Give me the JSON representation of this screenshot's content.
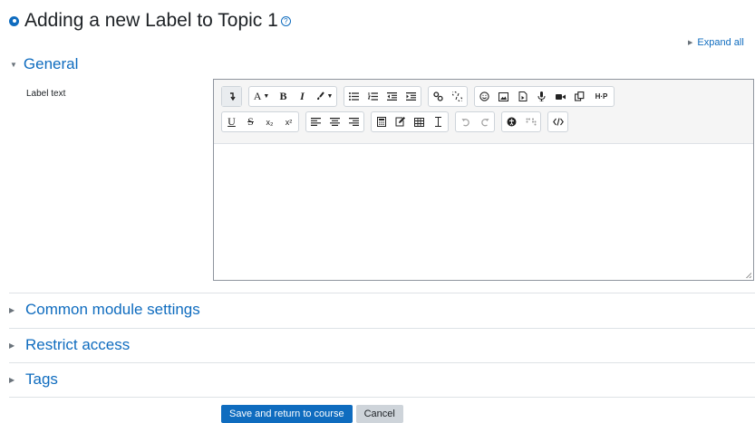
{
  "header": {
    "title": "Adding a new Label to Topic 1",
    "help_icon": "question-circle-icon"
  },
  "expand_all": "Expand all",
  "sections": {
    "general": "General",
    "common_module_settings": "Common module settings",
    "restrict_access": "Restrict access",
    "tags": "Tags"
  },
  "form": {
    "label_text": "Label text"
  },
  "toolbar": {
    "font_label": "A",
    "bold": "B",
    "italic": "I",
    "underline": "U",
    "strikethrough": "S",
    "subscript_label": "x₂",
    "superscript_label": "x²",
    "h5p_label": "H·P"
  },
  "buttons": {
    "save": "Save and return to course",
    "cancel": "Cancel"
  },
  "colors": {
    "accent": "#0f6cbf",
    "secondary_button": "#ced4da"
  }
}
